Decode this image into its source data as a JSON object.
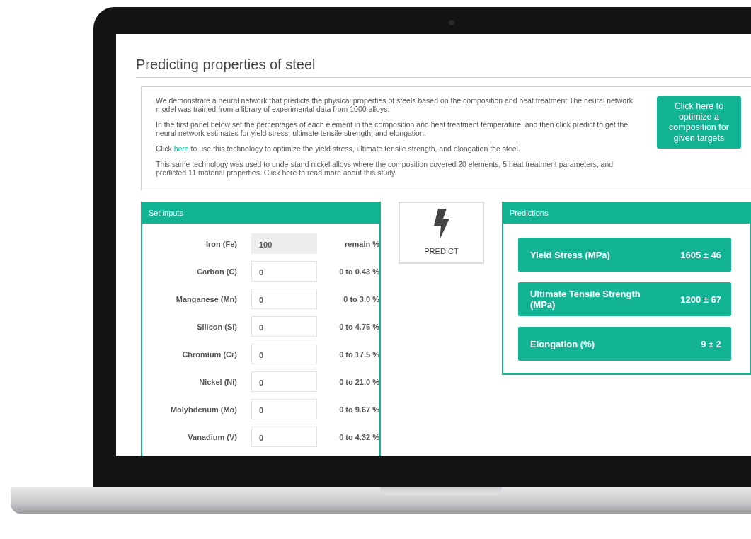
{
  "page_title": "Predicting properties of steel",
  "intro": {
    "paragraphs": [
      {
        "text": "We demonstrate a neural network that predicts the physical properties of steels based on the composition and heat treatment.The neural network model was trained from a library of experimental data from 1000 alloys."
      },
      {
        "text": "In the first panel below set the percentages of each element in the composition and heat treatment temperature, and then click predict to get the neural network estimates for yield stress, ultimate tensile strength, and elongation."
      },
      {
        "text": "Click ",
        "link": "here",
        "text_after": " to use this technology to optimize the yield stress, ultimate tensile strength, and elongation the steel."
      },
      {
        "text": "This same technology was used to understand nickel alloys where the composition covered 20 elements, 5 heat treatment parameters, and predicted 11 material properties. Click here to read more about this study."
      }
    ],
    "optimize_button": "Click here to optimize a composition for given targets"
  },
  "inputs_panel": {
    "title": "Set inputs",
    "rows": [
      {
        "label": "Iron (Fe)",
        "value": "100",
        "range": "remain %",
        "disabled": true
      },
      {
        "label": "Carbon (C)",
        "value": "0",
        "range": "0 to 0.43 %",
        "disabled": false
      },
      {
        "label": "Manganese (Mn)",
        "value": "0",
        "range": "0 to 3.0 %",
        "disabled": false
      },
      {
        "label": "Silicon (Si)",
        "value": "0",
        "range": "0 to 4.75 %",
        "disabled": false
      },
      {
        "label": "Chromium (Cr)",
        "value": "0",
        "range": "0 to 17.5 %",
        "disabled": false
      },
      {
        "label": "Nickel (Ni)",
        "value": "0",
        "range": "0 to 21.0 %",
        "disabled": false
      },
      {
        "label": "Molybdenum (Mo)",
        "value": "0",
        "range": "0 to 9.67 %",
        "disabled": false
      },
      {
        "label": "Vanadium (V)",
        "value": "0",
        "range": "0 to 4.32 %",
        "disabled": false
      }
    ]
  },
  "predict_button": "PREDICT",
  "predictions_panel": {
    "title": "Predictions",
    "items": [
      {
        "label": "Yield Stress (MPa)",
        "value": "1605",
        "pm": "±",
        "error": "46"
      },
      {
        "label": "Ultimate Tensile Strength (MPa)",
        "value": "1200",
        "pm": "±",
        "error": "67"
      },
      {
        "label": "Elongation (%)",
        "value": "9",
        "pm": "±",
        "error": "2"
      }
    ]
  }
}
